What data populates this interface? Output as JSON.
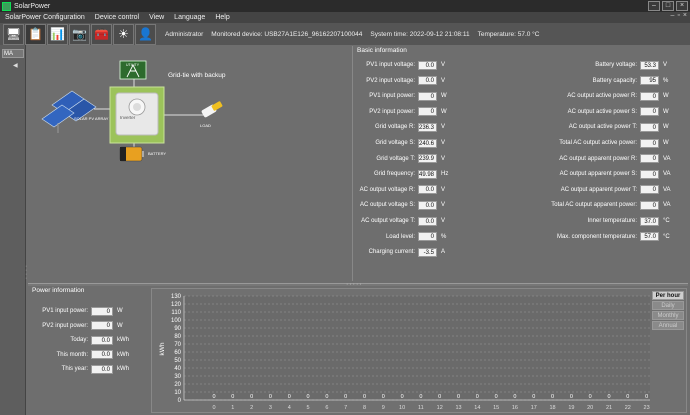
{
  "window": {
    "title": "SolarPower"
  },
  "menu": [
    "SolarPower Configuration",
    "Device control",
    "View",
    "Language",
    "Help"
  ],
  "toolbar": {
    "user": "Administrator",
    "monitored_device": "Monitored device:  USB27A1E126_96162207100044",
    "system_time": "System time:  2022-09-12 21:08:11",
    "temperature": "Temperature:  57.0 °C"
  },
  "left_tab": "MA",
  "diagram": {
    "backup_label": "Grid-tie with backup",
    "pv_label": "SOLAR PV ARRAY",
    "inverter_label": "Inverter",
    "load_label": "LOAD",
    "battery_label": "BATTERY",
    "grid_label": "UTILITY"
  },
  "basic_info": {
    "title": "Basic information",
    "left": [
      {
        "label": "PV1 input voltage:",
        "value": "0.0",
        "unit": "V"
      },
      {
        "label": "PV2 input voltage:",
        "value": "0.0",
        "unit": "V"
      },
      {
        "label": "PV1 input power:",
        "value": "0",
        "unit": "W"
      },
      {
        "label": "PV2 input power:",
        "value": "0",
        "unit": "W"
      },
      {
        "label": "Grid voltage R:",
        "value": "236.3",
        "unit": "V"
      },
      {
        "label": "Grid voltage S:",
        "value": "240.6",
        "unit": "V"
      },
      {
        "label": "Grid voltage T:",
        "value": "239.9",
        "unit": "V"
      },
      {
        "label": "Grid frequency:",
        "value": "49.98",
        "unit": "Hz"
      },
      {
        "label": "AC output voltage R:",
        "value": "0.0",
        "unit": "V"
      },
      {
        "label": "AC output voltage S:",
        "value": "0.0",
        "unit": "V"
      },
      {
        "label": "AC output voltage T:",
        "value": "0.0",
        "unit": "V"
      },
      {
        "label": "Load level:",
        "value": "0",
        "unit": "%"
      },
      {
        "label": "Charging current:",
        "value": "-3.5",
        "unit": "A"
      }
    ],
    "right": [
      {
        "label": "Battery voltage:",
        "value": "53.3",
        "unit": "V"
      },
      {
        "label": "Battery capacity:",
        "value": "95",
        "unit": "%"
      },
      {
        "label": "AC output active power R:",
        "value": "0",
        "unit": "W"
      },
      {
        "label": "AC output active power S:",
        "value": "0",
        "unit": "W"
      },
      {
        "label": "AC output active power T:",
        "value": "0",
        "unit": "W"
      },
      {
        "label": "Total AC output active power:",
        "value": "0",
        "unit": "W"
      },
      {
        "label": "AC output apparent power R:",
        "value": "0",
        "unit": "VA"
      },
      {
        "label": "AC output apparent power S:",
        "value": "0",
        "unit": "VA"
      },
      {
        "label": "AC output apparent power T:",
        "value": "0",
        "unit": "VA"
      },
      {
        "label": "Total AC output apparent power:",
        "value": "0",
        "unit": "VA"
      },
      {
        "label": "Inner temperature:",
        "value": "37.0",
        "unit": "°C"
      },
      {
        "label": "Max. component temperature:",
        "value": "57.0",
        "unit": "°C"
      }
    ]
  },
  "power_info": {
    "title": "Power information",
    "rows": [
      {
        "label": "PV1 input power:",
        "value": "0",
        "unit": "W"
      },
      {
        "label": "PV2 input power:",
        "value": "0",
        "unit": "W"
      },
      {
        "label": "Today:",
        "value": "0.0",
        "unit": "kWh"
      },
      {
        "label": "This month:",
        "value": "0.0",
        "unit": "kWh"
      },
      {
        "label": "This year:",
        "value": "0.0",
        "unit": "kWh"
      }
    ]
  },
  "period_tabs": [
    "Per hour",
    "Daily",
    "Monthly",
    "Annual"
  ],
  "chart_data": {
    "type": "bar",
    "ylabel": "kWh",
    "xlabel": "",
    "title": "",
    "ylim": [
      0,
      130
    ],
    "yticks": [
      0,
      10,
      20,
      30,
      40,
      50,
      60,
      70,
      80,
      90,
      100,
      110,
      120,
      130
    ],
    "categories": [
      "0",
      "1",
      "2",
      "3",
      "4",
      "5",
      "6",
      "7",
      "8",
      "9",
      "10",
      "11",
      "12",
      "13",
      "14",
      "15",
      "16",
      "17",
      "18",
      "19",
      "20",
      "21",
      "22",
      "23"
    ],
    "values": [
      0,
      0,
      0,
      0,
      0,
      0,
      0,
      0,
      0,
      0,
      0,
      0,
      0,
      0,
      0,
      0,
      0,
      0,
      0,
      0,
      0,
      0,
      0,
      0
    ],
    "value_labels": [
      "0",
      "0",
      "0",
      "0",
      "0",
      "0",
      "0",
      "0",
      "0",
      "0",
      "0",
      "0",
      "0",
      "0",
      "0",
      "0",
      "0",
      "0",
      "0",
      "0",
      "0",
      "0",
      "0",
      "0"
    ],
    "grid": true,
    "bar_color": "#ffff66"
  },
  "colors": {
    "background": "#6e6e6e",
    "titlebar": "#2b2b2b",
    "value_box": "#f2f2f2"
  }
}
